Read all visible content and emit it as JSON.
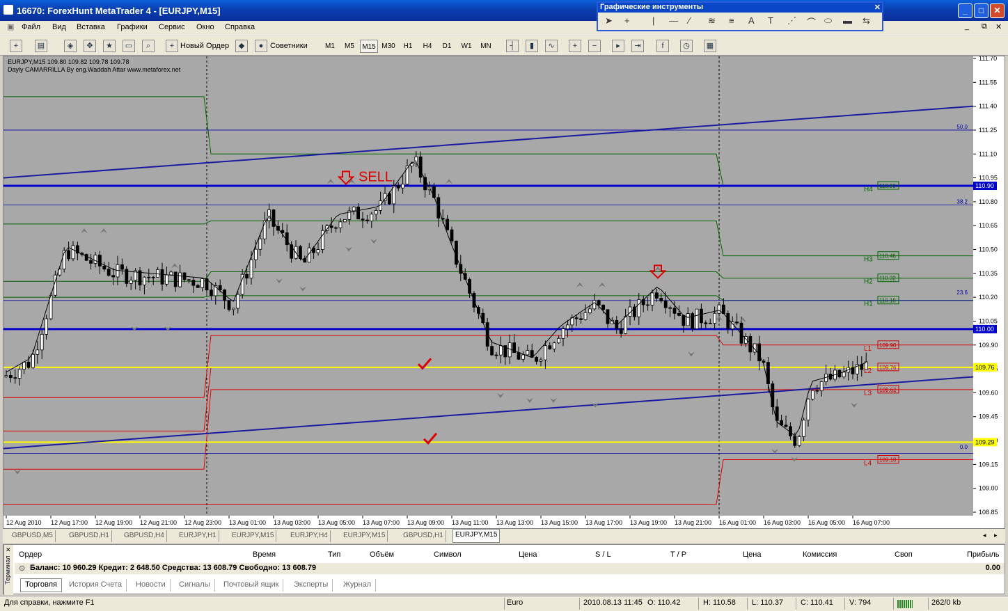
{
  "window": {
    "title": "16670: ForexHunt MetaTrader 4 - [EURJPY,M15]"
  },
  "menu": [
    "Файл",
    "Вид",
    "Вставка",
    "Графики",
    "Сервис",
    "Окно",
    "Справка"
  ],
  "toolbar": {
    "new_order": "Новый Ордер",
    "advisors": "Советники",
    "timeframes": [
      "M1",
      "M5",
      "M15",
      "M30",
      "H1",
      "H4",
      "D1",
      "W1",
      "MN"
    ],
    "selected_timeframe": "M15"
  },
  "drawing_toolbar": {
    "title": "Графические инструменты",
    "tools": [
      "cursor-icon",
      "crosshair-icon",
      "vertical-line-icon",
      "horizontal-line-icon",
      "trendline-icon",
      "channel-icon",
      "fibo-icon",
      "text-icon",
      "label-icon",
      "fibo-fan-icon",
      "fibo-arc-icon",
      "ellipse-icon",
      "rectangle-icon",
      "arrow-icon"
    ]
  },
  "chart": {
    "symbol_line": "EURJPY,M15  109.80 109.82 109.78 109.78",
    "indicator_name": "Dayly CAMARRILLA By eng.Waddah Attar www.metaforex.net",
    "sell_label": "SELL",
    "price_ticks": [
      "111.70",
      "111.55",
      "111.40",
      "111.25",
      "111.10",
      "110.95",
      "110.80",
      "110.65",
      "110.50",
      "110.35",
      "110.20",
      "110.05",
      "109.90",
      "109.75",
      "109.60",
      "109.45",
      "109.30",
      "109.15",
      "109.00",
      "108.85"
    ],
    "time_ticks": [
      "12 Aug 2010",
      "12 Aug 17:00",
      "12 Aug 19:00",
      "12 Aug 21:00",
      "12 Aug 23:00",
      "13 Aug 01:00",
      "13 Aug 03:00",
      "13 Aug 05:00",
      "13 Aug 07:00",
      "13 Aug 09:00",
      "13 Aug 11:00",
      "13 Aug 13:00",
      "13 Aug 15:00",
      "13 Aug 17:00",
      "13 Aug 19:00",
      "13 Aug 21:00",
      "16 Aug 01:00",
      "16 Aug 03:00",
      "16 Aug 05:00",
      "16 Aug 07:00"
    ],
    "price_marks": [
      {
        "label": "110.90",
        "color": "#0000cc"
      },
      {
        "label": "110.00",
        "color": "#0000cc"
      },
      {
        "label": "109.76",
        "color": "#ffff00"
      },
      {
        "label": "109.29",
        "color": "#ffff00"
      }
    ],
    "fibo_labels": [
      "50.0",
      "38.2",
      "23.6",
      "0.0"
    ],
    "camarilla": [
      {
        "name": "H4",
        "value": "110.90",
        "color": "#006600"
      },
      {
        "name": "H3",
        "value": "110.46",
        "color": "#006600"
      },
      {
        "name": "H2",
        "value": "110.32",
        "color": "#006600"
      },
      {
        "name": "H1",
        "value": "110.18",
        "color": "#006600"
      },
      {
        "name": "L1",
        "value": "109.90",
        "color": "#cc0000"
      },
      {
        "name": "L2",
        "value": "109.76",
        "color": "#cc0000"
      },
      {
        "name": "L3",
        "value": "109.62",
        "color": "#cc0000"
      },
      {
        "name": "L4",
        "value": "109.18",
        "color": "#cc0000"
      }
    ]
  },
  "chart_tabs": [
    "GBPUSD,M5",
    "GBPUSD,H1",
    "GBPUSD,H4",
    "EURJPY,H1",
    "EURJPY,M15",
    "EURJPY,H4",
    "EURJPY,M15",
    "GBPUSD,H1",
    "EURJPY,M15"
  ],
  "active_chart_tab": 8,
  "terminal": {
    "side_label": "Терминал",
    "columns": [
      "Ордер",
      "Время",
      "Тип",
      "Объём",
      "Символ",
      "Цена",
      "S / L",
      "T / P",
      "Цена",
      "Комиссия",
      "Своп",
      "Прибыль"
    ],
    "balance_line": "Баланс: 10 960.29  Кредит: 2 648.50  Средства: 13 608.79  Свободно: 13 608.79",
    "profit": "0.00",
    "tabs": [
      "Торговля",
      "История Счета",
      "Новости",
      "Сигналы",
      "Почтовый ящик",
      "Эксперты",
      "Журнал"
    ]
  },
  "status": {
    "help": "Для справки, нажмите F1",
    "profile": "Euro",
    "datetime": "2010.08.13 11:45",
    "open": "O: 110.42",
    "high": "H: 110.58",
    "low": "L: 110.37",
    "close": "C: 110.41",
    "volume": "V: 794",
    "traffic": "262/0 kb"
  }
}
